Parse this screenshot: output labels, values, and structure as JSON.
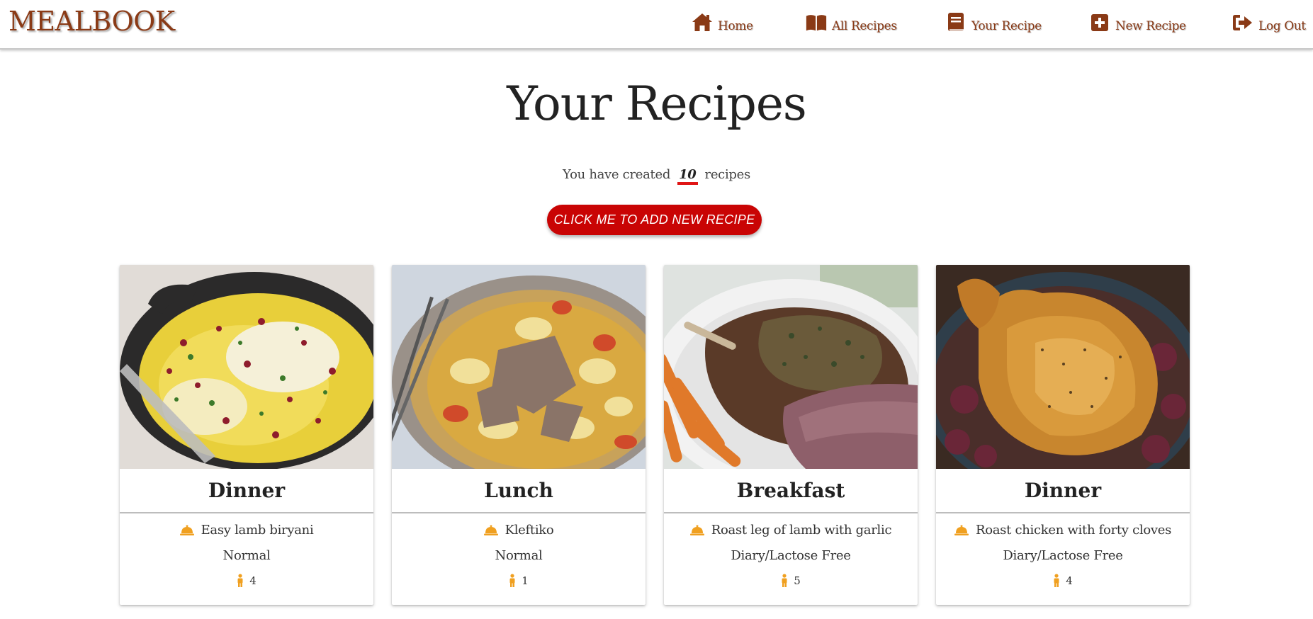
{
  "brand": "MEALBOOK",
  "nav": {
    "items": [
      {
        "label": "Home",
        "icon": "home-icon"
      },
      {
        "label": "All Recipes",
        "icon": "open-book-icon"
      },
      {
        "label": "Your Recipe",
        "icon": "book-icon"
      },
      {
        "label": "New Recipe",
        "icon": "plus-square-icon"
      },
      {
        "label": "Log Out",
        "icon": "sign-out-icon"
      }
    ]
  },
  "main": {
    "title": "Your Recipes",
    "count_prefix": "You have created",
    "count": "10",
    "count_suffix": "recipes",
    "add_button": "CLICK ME TO ADD NEW RECIPE"
  },
  "cards": [
    {
      "meal_type": "Dinner",
      "name": "Easy lamb biryani",
      "diet": "Normal",
      "servings": "4",
      "image": "lamb biryani in black pan"
    },
    {
      "meal_type": "Lunch",
      "name": "Kleftiko",
      "diet": "Normal",
      "servings": "1",
      "image": "kleftiko with potatoes and tomatoes"
    },
    {
      "meal_type": "Breakfast",
      "name": "Roast leg of lamb with garlic",
      "diet": "Diary/Lactose Free",
      "servings": "5",
      "image": "roast leg of lamb with carrots"
    },
    {
      "meal_type": "Dinner",
      "name": "Roast chicken with forty cloves",
      "diet": "Diary/Lactose Free",
      "servings": "4",
      "image": "roast chicken"
    }
  ],
  "colors": {
    "brand": "#8a3a16",
    "button": "#c90404",
    "accent_icon": "#f0a020",
    "count_underline": "#e01515"
  }
}
